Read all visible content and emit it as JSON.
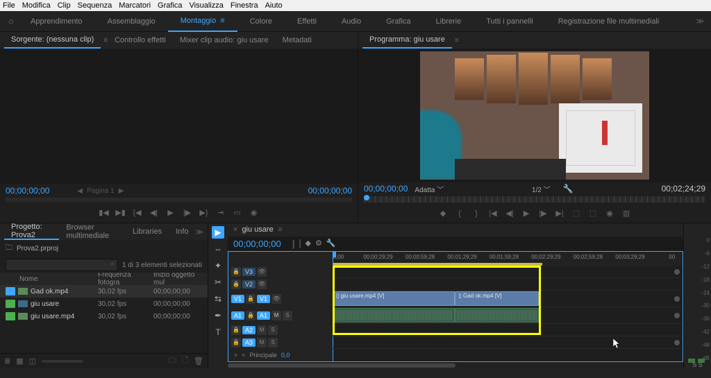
{
  "menu": [
    "File",
    "Modifica",
    "Clip",
    "Sequenza",
    "Marcatori",
    "Grafica",
    "Visualizza",
    "Finestra",
    "Aiuto"
  ],
  "workspaces": {
    "items": [
      "Apprendimento",
      "Assemblaggio",
      "Montaggio",
      "Colore",
      "Effetti",
      "Audio",
      "Grafica",
      "Librerie",
      "Tutti i pannelli",
      "Registrazione file multimediali"
    ],
    "active_index": 2
  },
  "source_panel": {
    "tabs": [
      "Sorgente: (nessuna clip)",
      "Controllo effetti",
      "Mixer clip audio: giu usare",
      "Metadati"
    ],
    "active_tab": 0,
    "left_tc": "00;00;00;00",
    "page_label": "Pagina 1",
    "right_tc": "00;00;00;00"
  },
  "program_panel": {
    "title": "Programma: giu usare",
    "left_tc": "00;00;00;00",
    "fit_label": "Adatta",
    "scale": "1/2",
    "duration": "00;02;24;29"
  },
  "project_panel": {
    "tabs": [
      "Progetto: Prova2",
      "Browser multimediale",
      "Libraries",
      "Info"
    ],
    "active_tab": 0,
    "file_label": "Prova2.prproj",
    "selection_info": "1 di 3 elementi selezionati",
    "columns": [
      "",
      "Nome",
      "Frequenza fotogra",
      "Inizio oggetto mul"
    ],
    "rows": [
      {
        "sel": true,
        "color": "blue",
        "type": "video",
        "name": "Gad ok.mp4",
        "fps": "30,02 fps",
        "start": "00;00;00;00"
      },
      {
        "sel": false,
        "color": "green",
        "type": "seq",
        "name": "giu usare",
        "fps": "30,02 fps",
        "start": "00;00;00;00"
      },
      {
        "sel": false,
        "color": "green",
        "type": "video",
        "name": "giu usare.mp4",
        "fps": "30,02 fps",
        "start": "00;00;00;00"
      }
    ]
  },
  "timeline": {
    "seq_name": "giu usare",
    "playhead_tc": "00;00;00;00",
    "ruler": [
      ";00;00",
      "00;00;29;29",
      "00;00;59;28",
      "00;01;29;29",
      "00;01;59;28",
      "00;02;29;29",
      "00;02;59;28",
      "00;03;29;29",
      "00"
    ],
    "footer_label": "Principale",
    "footer_value": "0,0",
    "clips": {
      "v1a": "giu usare.mp4 [V]",
      "v1b": "Gad ok.mp4 [V]"
    },
    "tracks_v": [
      "V3",
      "V2",
      "V1"
    ],
    "tracks_a": [
      "A1",
      "A2",
      "A3"
    ]
  },
  "meter": {
    "scale": [
      "0",
      "-6",
      "-12",
      "-18",
      "-24",
      "-30",
      "-36",
      "-42",
      "-48",
      "dB"
    ],
    "solo": "S"
  },
  "tools": [
    "▶",
    "⇔",
    "✦",
    "✂",
    "⇆",
    "✒",
    "T"
  ]
}
